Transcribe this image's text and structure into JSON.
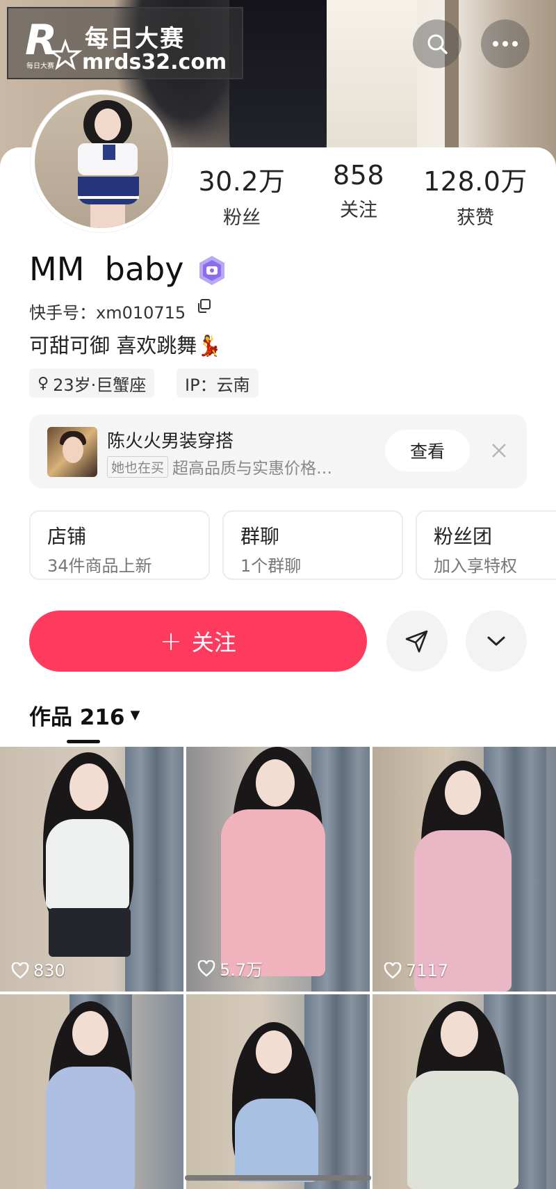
{
  "watermark": {
    "title": "每日大赛",
    "url": "mrds32.com",
    "logo_letter": "R",
    "logo_small": "每日大赛"
  },
  "header": {
    "search_icon": "search-icon",
    "more_icon": "more-icon"
  },
  "profile": {
    "stats": [
      {
        "value": "30.2万",
        "label": "粉丝"
      },
      {
        "value": "858",
        "label": "关注"
      },
      {
        "value": "128.0万",
        "label": "获赞"
      }
    ],
    "name": "MM  baby",
    "kuaishou_id": "快手号：xm010715",
    "bio": "可甜可御 喜欢跳舞💃",
    "tags": [
      {
        "icon": "♀",
        "text": "23岁·巨蟹座"
      },
      {
        "text": "IP：云南"
      }
    ]
  },
  "promo": {
    "name": "陈火火男装穿搭",
    "chip": "她也在买",
    "subtitle": "超高品质与实惠价格…",
    "button": "查看"
  },
  "features": [
    {
      "title": "店铺",
      "subtitle": "34件商品上新"
    },
    {
      "title": "群聊",
      "subtitle": "1个群聊"
    },
    {
      "title": "粉丝团",
      "subtitle": "加入享特权"
    }
  ],
  "actions": {
    "follow_plus": "+",
    "follow_label": "关注"
  },
  "works": {
    "label": "作品 216",
    "caret": "▼"
  },
  "videos": [
    {
      "likes": "830"
    },
    {
      "likes": "5.7万"
    },
    {
      "likes": "7117"
    },
    {
      "likes": ""
    },
    {
      "likes": ""
    },
    {
      "likes": ""
    }
  ],
  "colors": {
    "follow": "#fe3b5f",
    "badge": "#8b6cf0"
  }
}
